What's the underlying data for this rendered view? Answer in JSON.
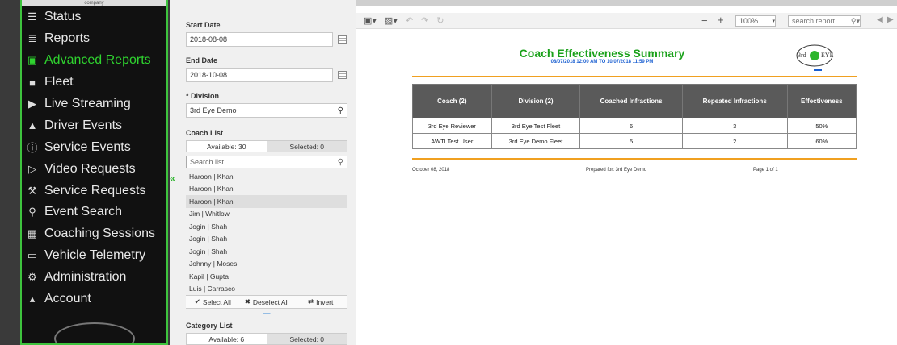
{
  "sidebar": {
    "brand_text": "company",
    "items": [
      {
        "label": "Status",
        "icon": "list-icon"
      },
      {
        "label": "Reports",
        "icon": "document-icon"
      },
      {
        "label": "Advanced Reports",
        "icon": "chart-icon",
        "active": true
      },
      {
        "label": "Fleet",
        "icon": "truck-icon"
      },
      {
        "label": "Live Streaming",
        "icon": "video-camera-icon"
      },
      {
        "label": "Driver Events",
        "icon": "warning-icon"
      },
      {
        "label": "Service Events",
        "icon": "info-icon"
      },
      {
        "label": "Video Requests",
        "icon": "play-icon"
      },
      {
        "label": "Service Requests",
        "icon": "wrench-icon"
      },
      {
        "label": "Event Search",
        "icon": "search-icon"
      },
      {
        "label": "Coaching Sessions",
        "icon": "calendar-icon"
      },
      {
        "label": "Vehicle Telemetry",
        "icon": "monitor-icon"
      },
      {
        "label": "Administration",
        "icon": "gear-icon"
      },
      {
        "label": "Account",
        "icon": "user-icon"
      }
    ]
  },
  "filters": {
    "start_date_label": "Start Date",
    "start_date_value": "2018-08-08",
    "end_date_label": "End Date",
    "end_date_value": "2018-10-08",
    "division_label": "* Division",
    "division_value": "3rd Eye Demo",
    "coach_list_label": "Coach List",
    "available_label": "Available: 30",
    "selected_label": "Selected: 0",
    "search_placeholder": "Search list...",
    "coaches": [
      "Haroon | Khan",
      "Haroon | Khan",
      "Haroon | Khan",
      "Jim | Whitlow",
      "Jogin | Shah",
      "Jogin | Shah",
      "Jogin | Shah",
      "Johnny | Moses",
      "Kapil | Gupta",
      "Luis | Carrasco"
    ],
    "selected_coach_index": 2,
    "select_all": "Select All",
    "deselect_all": "Deselect All",
    "invert": "Invert",
    "category_list_label": "Category List",
    "category_available": "Available: 6",
    "category_selected": "Selected: 0"
  },
  "toolbar": {
    "zoom": "100%",
    "search_placeholder": "search report"
  },
  "report": {
    "title": "Coach Effectiveness Summary",
    "subtitle": "08/07/2018 12:00 AM  TO  10/07/2018 11:59 PM",
    "logo_text": "3rd EYE",
    "columns": [
      "Coach (2)",
      "Division (2)",
      "Coached Infractions",
      "Repeated Infractions",
      "Effectiveness"
    ],
    "rows": [
      [
        "3rd Eye Reviewer",
        "3rd Eye Test Fleet",
        "6",
        "3",
        "50%"
      ],
      [
        "AWTI Test User",
        "3rd Eye Demo Fleet",
        "5",
        "2",
        "60%"
      ]
    ],
    "footer_date": "October 08, 2018",
    "footer_prepared": "Prepared for: 3rd Eye Demo",
    "footer_page": "Page 1 of 1"
  }
}
